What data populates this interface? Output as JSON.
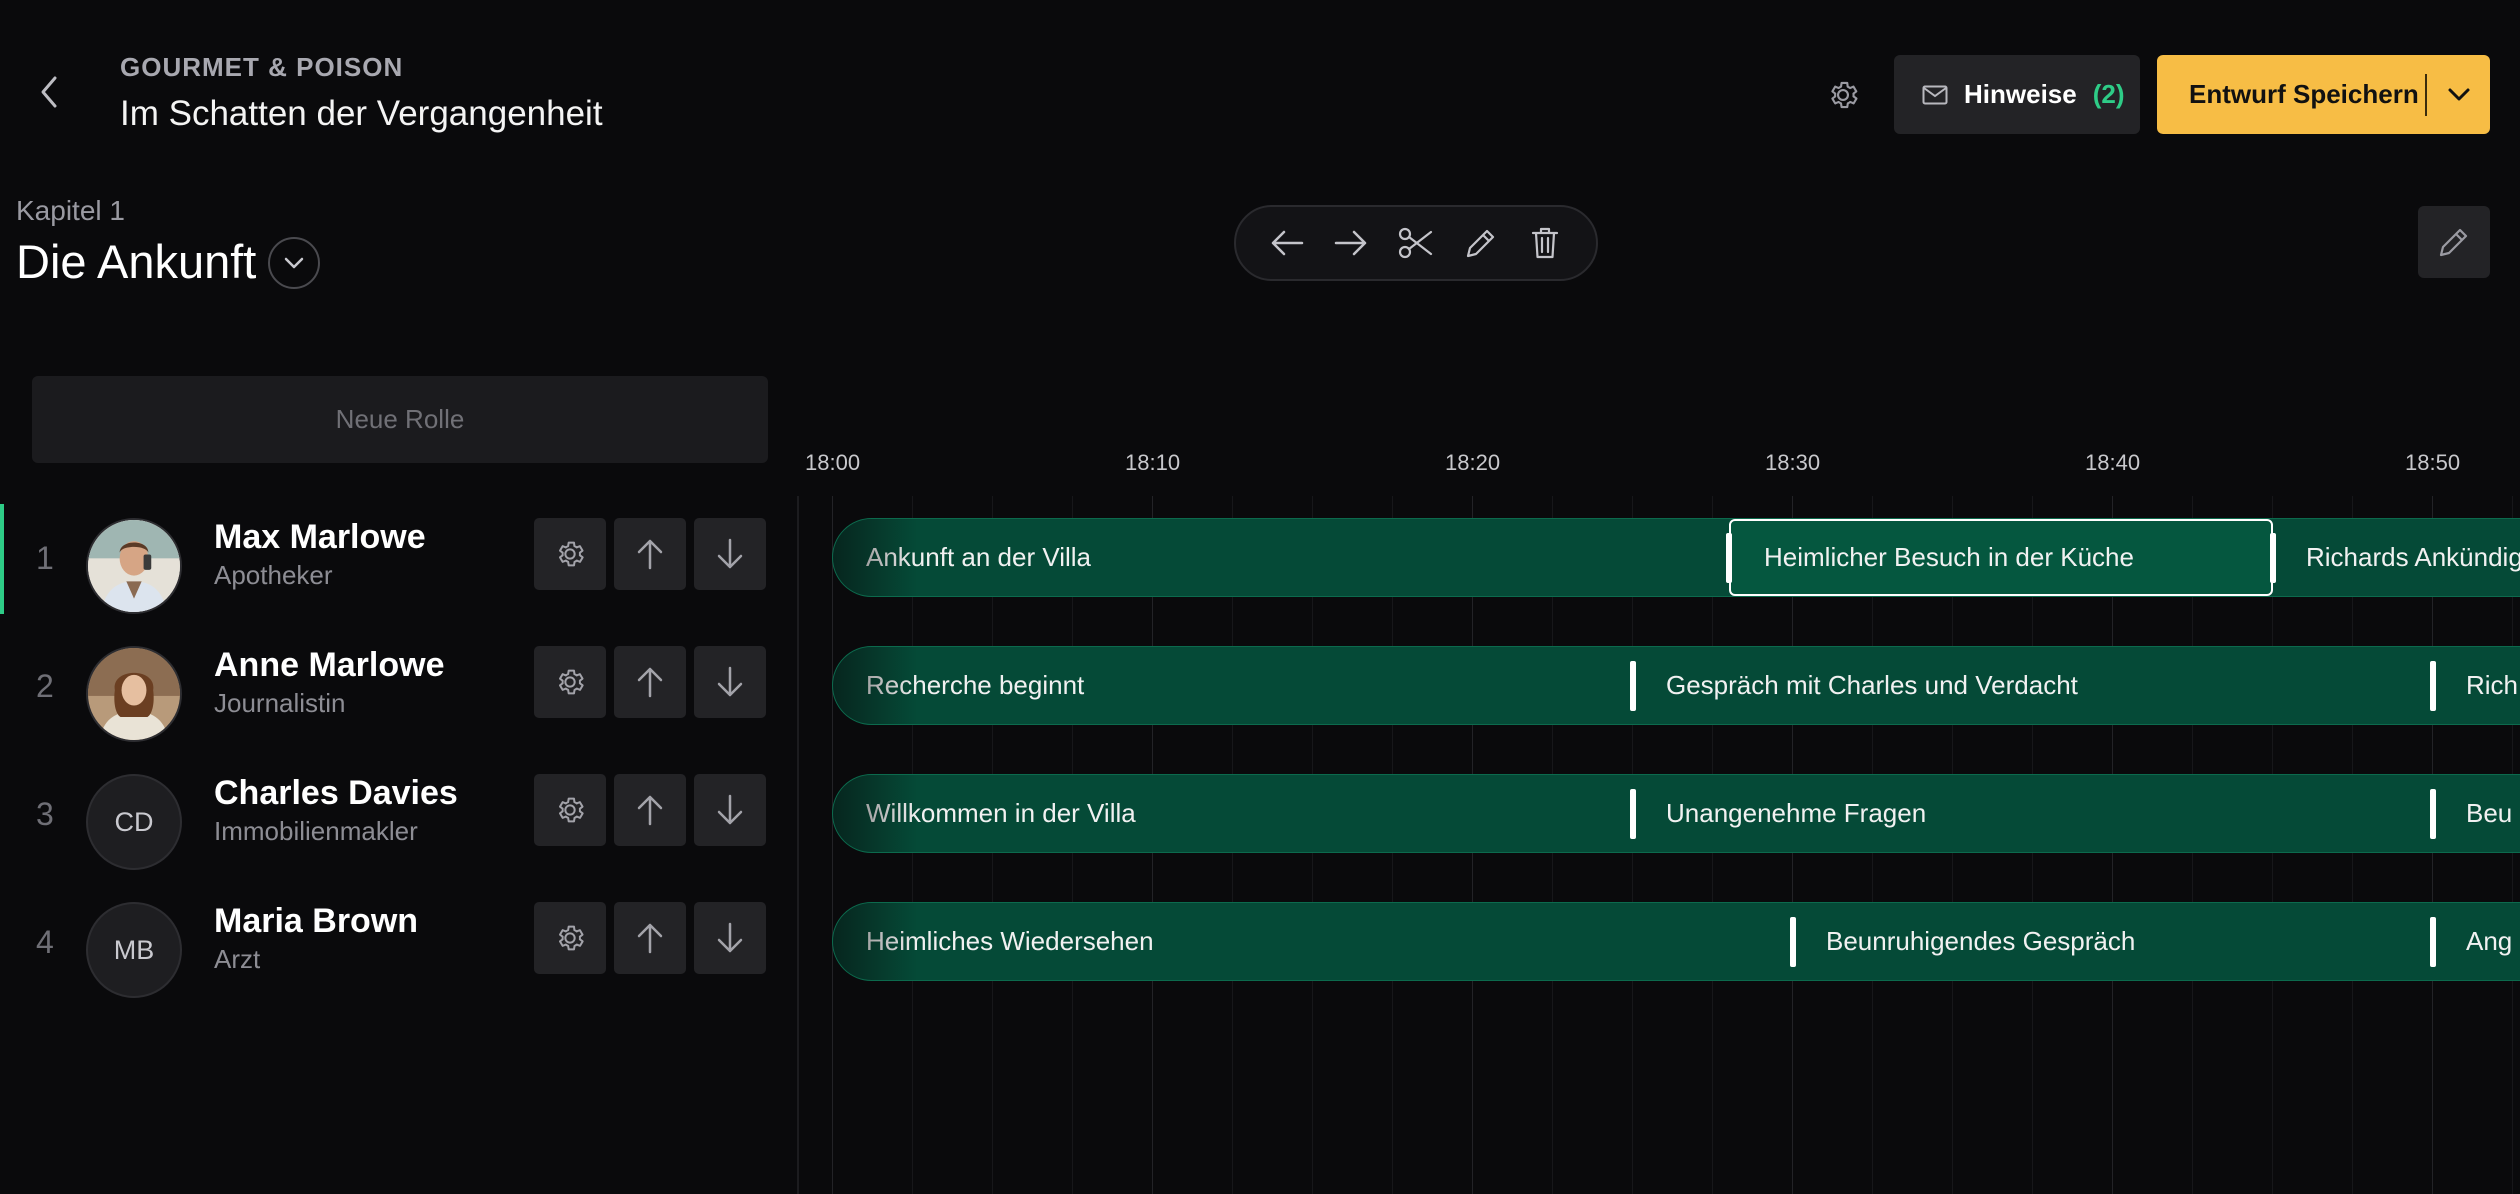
{
  "header": {
    "brand": "GOURMET & POISON",
    "title": "Im Schatten der Vergangenheit",
    "hints_label": "Hinweise",
    "hints_count": "(2)",
    "save_label": "Entwurf Speichern"
  },
  "chapter": {
    "kicker": "Kapitel 1",
    "title": "Die Ankunft"
  },
  "toolbar": {
    "icons": [
      "arrow-left-icon",
      "arrow-right-icon",
      "scissors-icon",
      "pencil-icon",
      "trash-icon"
    ]
  },
  "roles_panel": {
    "new_role_label": "Neue Rolle",
    "roles": [
      {
        "num": "1",
        "name": "Max Marlowe",
        "subtitle": "Apotheker",
        "initials": ""
      },
      {
        "num": "2",
        "name": "Anne Marlowe",
        "subtitle": "Journalistin",
        "initials": ""
      },
      {
        "num": "3",
        "name": "Charles Davies",
        "subtitle": "Immobilienmakler",
        "initials": "CD"
      },
      {
        "num": "4",
        "name": "Maria Brown",
        "subtitle": "Arzt",
        "initials": "MB"
      }
    ]
  },
  "timeline": {
    "ticks": [
      "18:00",
      "18:10",
      "18:20",
      "18:30",
      "18:40",
      "18:50"
    ],
    "lanes": [
      {
        "segments": [
          {
            "label": "Ankunft an der Villa"
          },
          {
            "label": "Heimlicher Besuch in der Küche",
            "selected": true
          },
          {
            "label": "Richards Ankündig"
          }
        ]
      },
      {
        "segments": [
          {
            "label": "Recherche beginnt"
          },
          {
            "label": "Gespräch mit Charles und Verdacht"
          },
          {
            "label": "Rich"
          }
        ]
      },
      {
        "segments": [
          {
            "label": "Willkommen in der Villa"
          },
          {
            "label": "Unangenehme Fragen"
          },
          {
            "label": "Beu"
          }
        ]
      },
      {
        "segments": [
          {
            "label": "Heimliches Wiedersehen"
          },
          {
            "label": "Beunruhigendes Gespräch"
          },
          {
            "label": "Ang"
          }
        ]
      }
    ]
  },
  "colors": {
    "accent_green": "#2ecc87",
    "lane_green": "#054a37",
    "save_yellow": "#f7bd45",
    "background": "#0a0a0c"
  }
}
